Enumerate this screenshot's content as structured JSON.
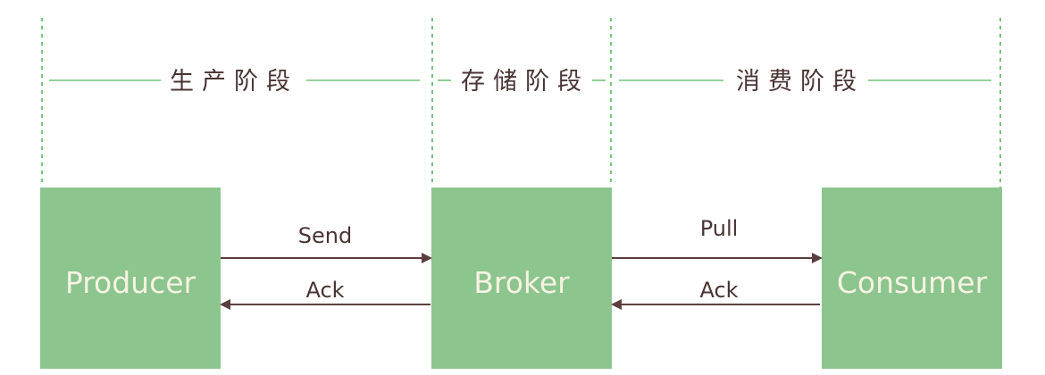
{
  "colors": {
    "background": "#ffffff",
    "guide": "#74c27a",
    "box_fill": "#8cc58e",
    "box_text": "#f6f3e2",
    "text": "#4a3434",
    "arrow": "#5b3f3f"
  },
  "stages": [
    {
      "label": "生产阶段"
    },
    {
      "label": "存储阶段"
    },
    {
      "label": "消费阶段"
    }
  ],
  "nodes": [
    {
      "label": "Producer"
    },
    {
      "label": "Broker"
    },
    {
      "label": "Consumer"
    }
  ],
  "edges": [
    {
      "label": "Send",
      "from": 0,
      "to": 1
    },
    {
      "label": "Ack",
      "from": 1,
      "to": 0
    },
    {
      "label": "Pull",
      "from": 1,
      "to": 2
    },
    {
      "label": "Ack",
      "from": 2,
      "to": 1
    }
  ]
}
